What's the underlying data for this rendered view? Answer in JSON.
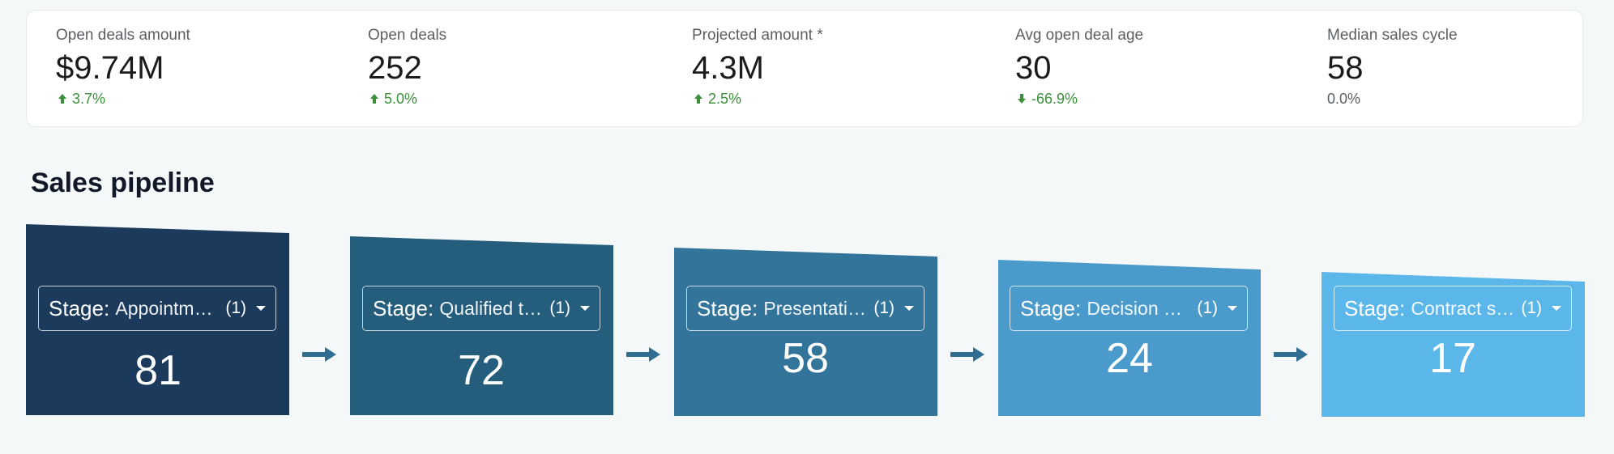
{
  "kpis": [
    {
      "label": "Open deals amount",
      "value": "$9.74M",
      "delta": "3.7%",
      "direction": "up"
    },
    {
      "label": "Open deals",
      "value": "252",
      "delta": "5.0%",
      "direction": "up"
    },
    {
      "label": "Projected amount *",
      "value": "4.3M",
      "delta": "2.5%",
      "direction": "up"
    },
    {
      "label": "Avg open deal age",
      "value": "30",
      "delta": "-66.9%",
      "direction": "down"
    },
    {
      "label": "Median sales cycle",
      "value": "58",
      "delta": "0.0%",
      "direction": "none"
    }
  ],
  "colors": {
    "positive": "#3a8f3a",
    "neutral": "#5a5f63",
    "arrow": "#2f6e92",
    "stages": [
      "#1b3a5c",
      "#255d7c",
      "#33749b",
      "#4a9bcb",
      "#5bb6ea"
    ]
  },
  "pipeline": {
    "title": "Sales pipeline",
    "stages": [
      {
        "key": "Stage",
        "value": "Appointment scheduled",
        "selected": "(1)",
        "count": "81"
      },
      {
        "key": "Stage",
        "value": "Qualified to buy",
        "selected": "(1)",
        "count": "72"
      },
      {
        "key": "Stage",
        "value": "Presentation scheduled",
        "selected": "(1)",
        "count": "58"
      },
      {
        "key": "Stage",
        "value": "Decision maker bought-in",
        "selected": "(1)",
        "count": "24"
      },
      {
        "key": "Stage",
        "value": "Contract sent",
        "selected": "(1)",
        "count": "17"
      }
    ]
  }
}
